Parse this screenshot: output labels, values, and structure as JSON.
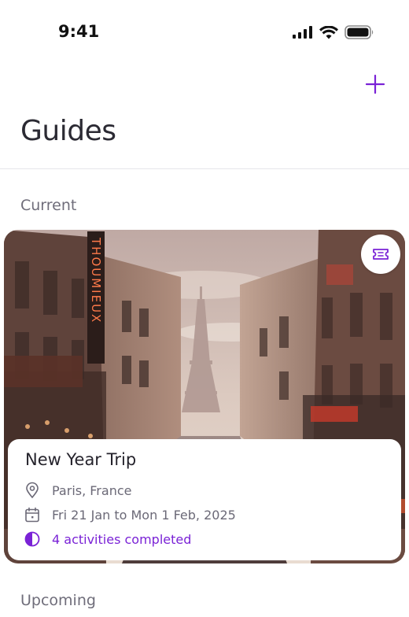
{
  "status_bar": {
    "time": "9:41"
  },
  "header": {
    "title": "Guides",
    "add_icon": "plus-icon"
  },
  "sections": {
    "current_label": "Current",
    "upcoming_label": "Upcoming"
  },
  "trip": {
    "title": "New Year Trip",
    "location": "Paris, France",
    "dates": "Fri 21 Jan to Mon 1 Feb, 2025",
    "activities": "4 activities completed",
    "sign_text": "THOUMIEUX",
    "ticket_icon": "ticket-icon"
  },
  "colors": {
    "accent": "#7a22d6",
    "text": "#26242e",
    "muted": "#6f6d7a"
  }
}
